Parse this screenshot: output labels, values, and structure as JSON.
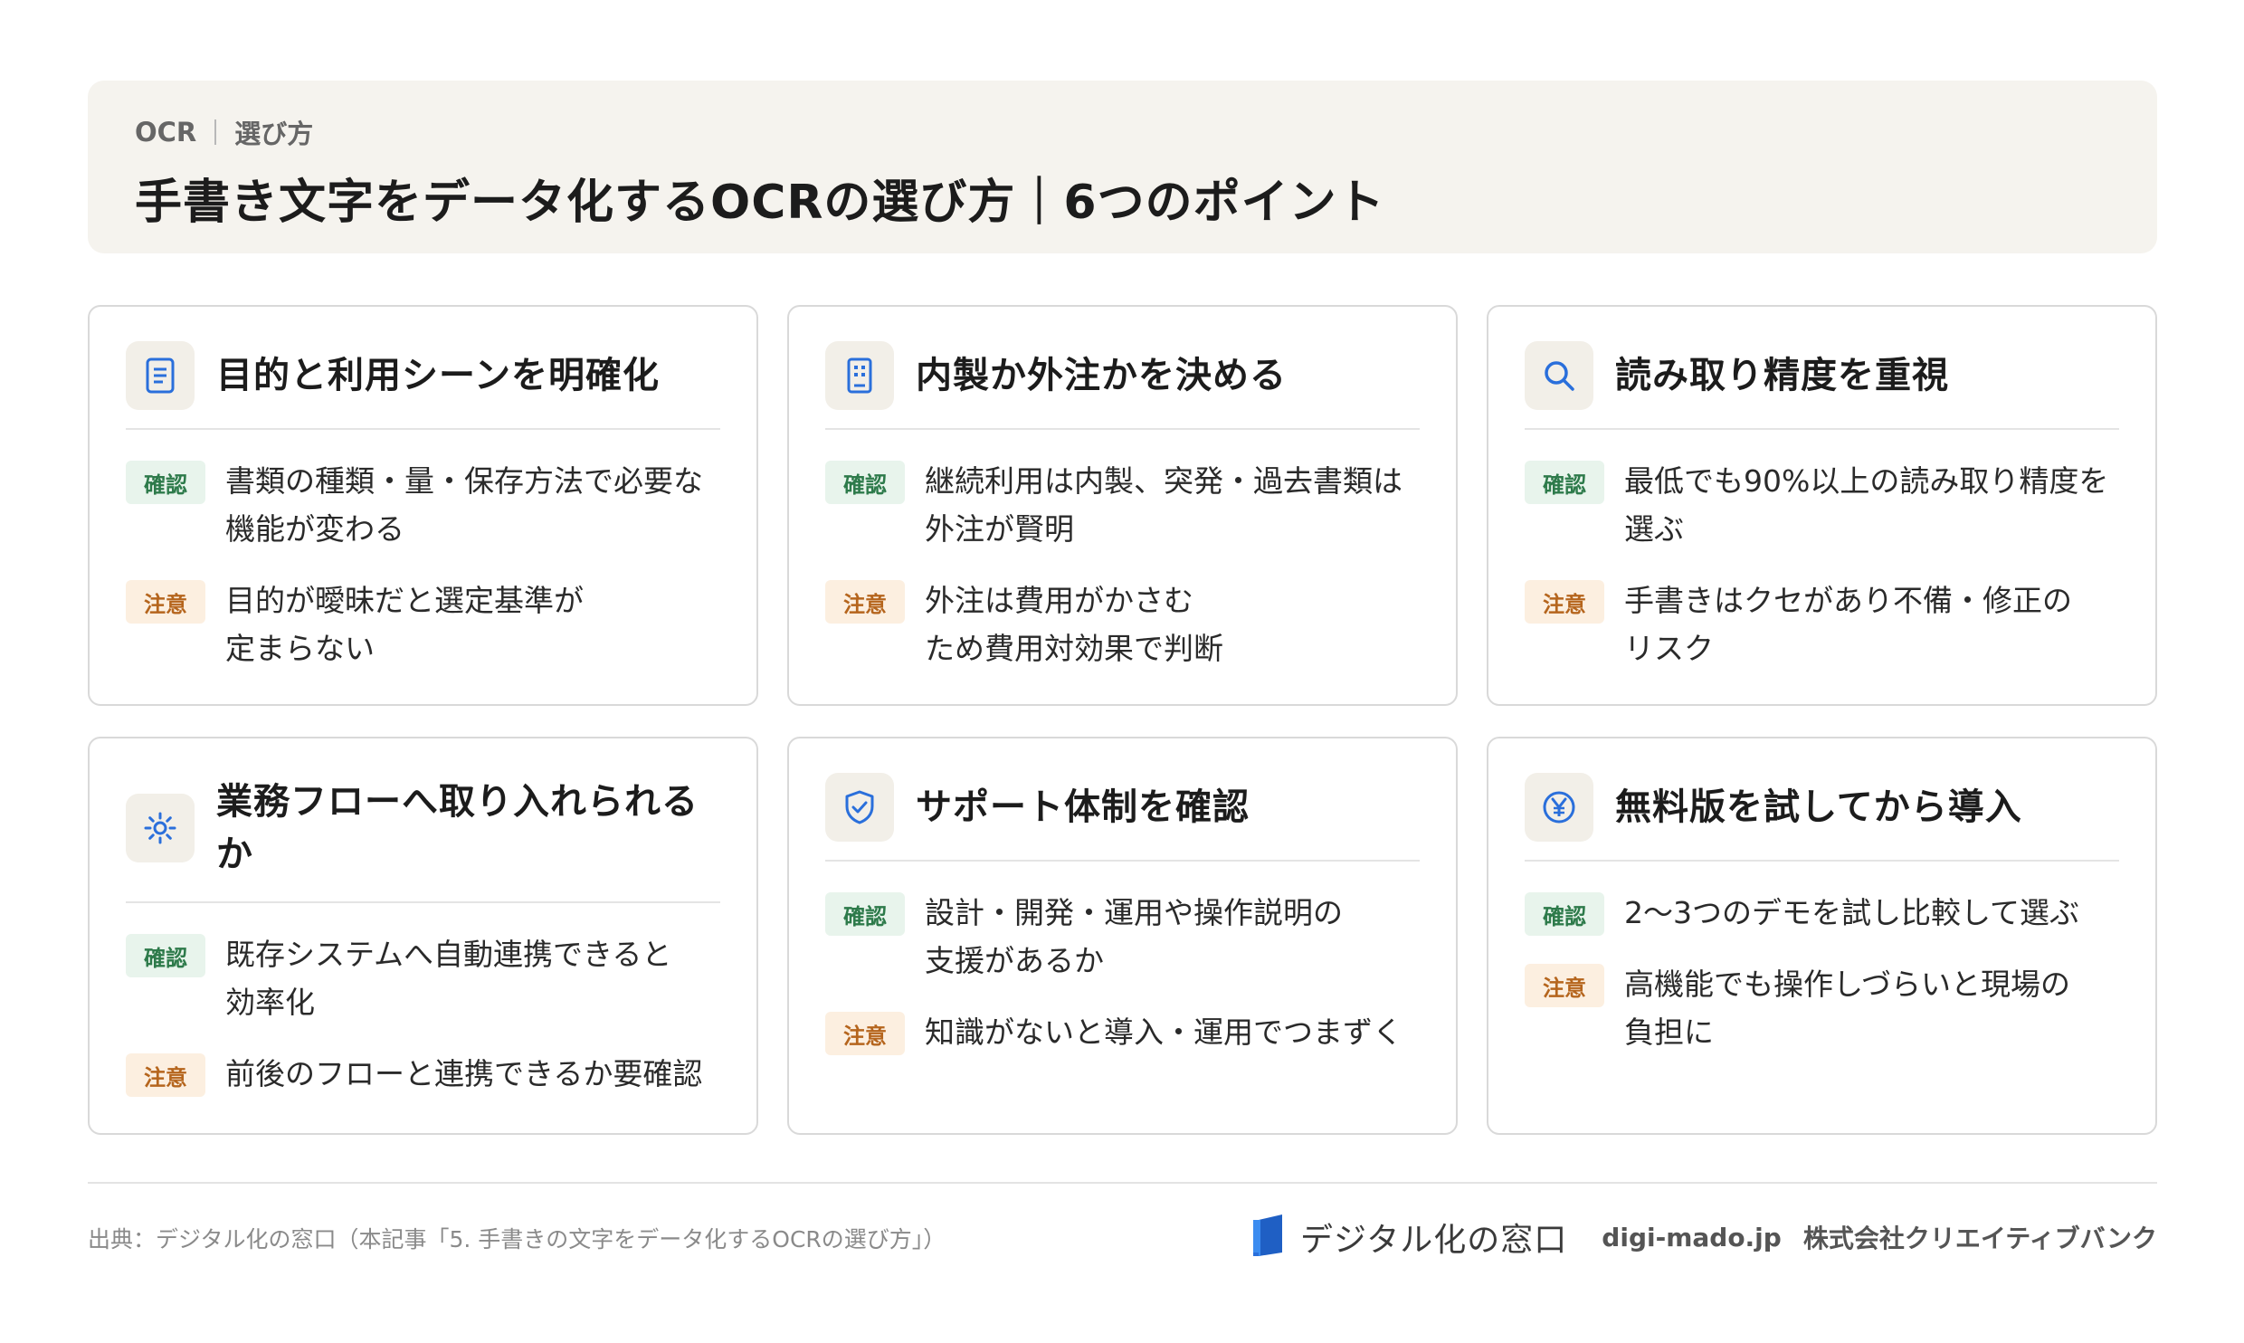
{
  "header": {
    "breadcrumb": [
      "OCR",
      "選び方"
    ],
    "title": "手書き文字をデータ化するOCRの選び方｜6つのポイント"
  },
  "labels": {
    "confirm": "確認",
    "caution": "注意"
  },
  "cards": [
    {
      "icon": "document-icon",
      "title": "目的と利用シーンを明確化",
      "confirm": "書類の種類・量・保存方法で必要な\n機能が変わる",
      "caution": "目的が曖昧だと選定基準が\n定まらない"
    },
    {
      "icon": "building-icon",
      "title": "内製か外注かを決める",
      "confirm": "継続利用は内製、突発・過去書類は\n外注が賢明",
      "caution": "外注は費用がかさむ\nため費用対効果で判断"
    },
    {
      "icon": "search-icon",
      "title": "読み取り精度を重視",
      "confirm": "最低でも90%以上の読み取り精度を\n選ぶ",
      "caution": "手書きはクセがあり不備・修正の\nリスク"
    },
    {
      "icon": "gear-icon",
      "title": "業務フローへ取り入れられる\nか",
      "confirm": "既存システムへ自動連携できると\n効率化",
      "caution": "前後のフローと連携できるか要確認"
    },
    {
      "icon": "shield-check-icon",
      "title": "サポート体制を確認",
      "confirm": "設計・開発・運用や操作説明の\n支援があるか",
      "caution": "知識がないと導入・運用でつまずく"
    },
    {
      "icon": "yen-icon",
      "title": "無料版を試してから導入",
      "confirm": "2〜3つのデモを試し比較して選ぶ",
      "caution": "高機能でも操作しづらいと現場の\n負担に"
    }
  ],
  "footer": {
    "source": "出典：デジタル化の窓口（本記事「5. 手書きの文字をデータ化するOCRの選び方」）",
    "brand_name": "デジタル化の窓口",
    "domain": "digi-mado.jp",
    "company": "株式会社クリエイティブバンク"
  },
  "colors": {
    "accent_blue": "#2a6fdb",
    "confirm_green": "#2d7a4a",
    "caution_orange": "#b5651d"
  }
}
